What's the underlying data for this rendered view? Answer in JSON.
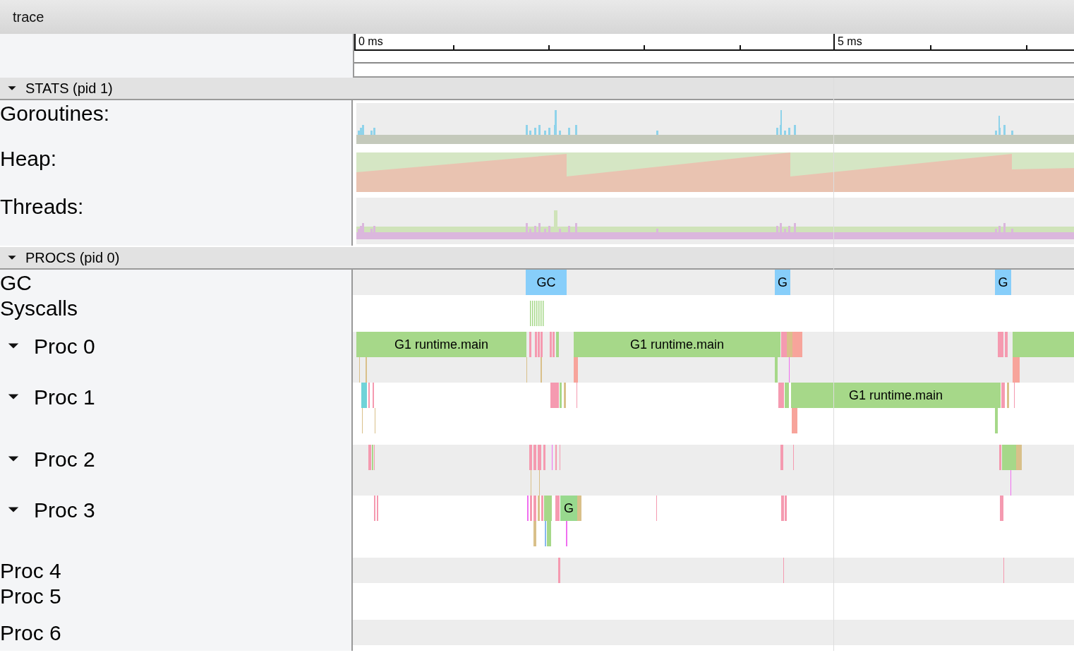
{
  "title": "trace",
  "ruler": {
    "labels": [
      "0 ms",
      "5 ms"
    ]
  },
  "sections": [
    {
      "title": "STATS (pid 1)",
      "expanded": true,
      "tracks": [
        {
          "name": "Goroutines:",
          "kind": "goroutines"
        },
        {
          "name": "Heap:",
          "kind": "heap"
        },
        {
          "name": "Threads:",
          "kind": "threads"
        }
      ]
    },
    {
      "title": "PROCS (pid 0)",
      "expanded": true,
      "tracks": [
        {
          "name": "GC",
          "kind": "row",
          "slices": [
            {
              "label": "GC"
            },
            {
              "label": "G"
            },
            {
              "label": "G"
            }
          ]
        },
        {
          "name": "Syscalls",
          "kind": "row"
        },
        {
          "name": "Proc 0",
          "kind": "group",
          "expanded": true,
          "slices": [
            {
              "label": "G1 runtime.main"
            },
            {
              "label": "G1 runtime.main"
            }
          ]
        },
        {
          "name": "Proc 1",
          "kind": "group",
          "expanded": true,
          "slices": [
            {
              "label": "G1 runtime.main"
            }
          ]
        },
        {
          "name": "Proc 2",
          "kind": "group",
          "expanded": true
        },
        {
          "name": "Proc 3",
          "kind": "group",
          "expanded": true,
          "slices": [
            {
              "label": "G"
            }
          ]
        },
        {
          "name": "Proc 4",
          "kind": "row"
        },
        {
          "name": "Proc 5",
          "kind": "row"
        },
        {
          "name": "Proc 6",
          "kind": "row"
        }
      ]
    }
  ]
}
